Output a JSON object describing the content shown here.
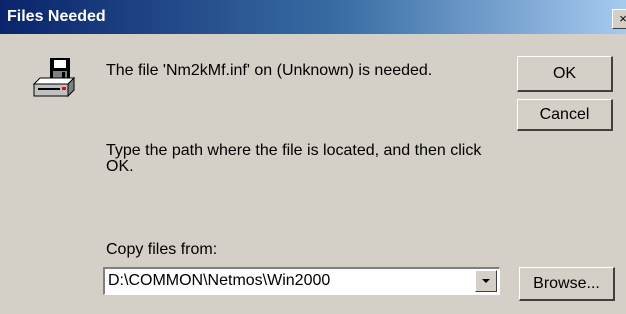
{
  "window": {
    "title": "Files Needed",
    "close_glyph": "×"
  },
  "message": {
    "icon": "disk-drive-icon",
    "file_needed": "The file 'Nm2kMf.inf' on (Unknown) is needed.",
    "instruction_line1": "Type the path where the file is located, and then click",
    "instruction_line2": "OK."
  },
  "buttons": {
    "ok_label": "OK",
    "cancel_label": "Cancel",
    "browse_label": "Browse..."
  },
  "copy_from": {
    "label": "Copy files from:",
    "value": "D:\\COMMON\\Netmos\\Win2000"
  },
  "colors": {
    "dialog_bg": "#d4d0c8",
    "title_start": "#0a246a",
    "title_end": "#a6caf0"
  }
}
